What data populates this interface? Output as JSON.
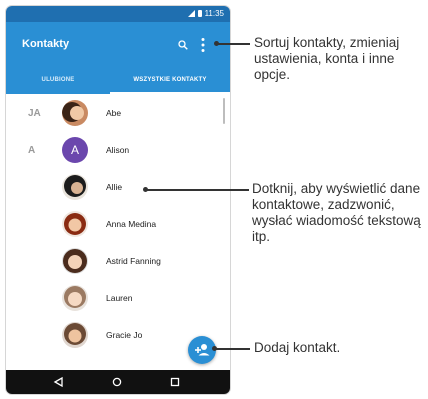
{
  "status_bar": {
    "time": "11:35"
  },
  "app_bar": {
    "title": "Kontakty"
  },
  "tabs": [
    {
      "label": "ULUBIONE",
      "active": false
    },
    {
      "label": "WSZYSTKIE KONTAKTY",
      "active": true
    }
  ],
  "contacts": [
    {
      "section": "JA",
      "name": "Abe",
      "avatar": "photo"
    },
    {
      "section": "A",
      "name": "Alison",
      "avatar": "letter",
      "initial": "A"
    },
    {
      "section": "",
      "name": "Allie",
      "avatar": "photo"
    },
    {
      "section": "",
      "name": "Anna Medina",
      "avatar": "photo"
    },
    {
      "section": "",
      "name": "Astrid Fanning",
      "avatar": "photo"
    },
    {
      "section": "",
      "name": "Lauren",
      "avatar": "photo"
    },
    {
      "section": "",
      "name": "Gracie Jo",
      "avatar": "photo"
    }
  ],
  "callouts": {
    "menu": "Sortuj kontakty, zmieniaj ustawienia, konta i inne opcje.",
    "contact": "Dotknij, aby wyświetlić dane kontaktowe, zadzwonić, wysłać wiadomość tekstową itp.",
    "add": "Dodaj kontakt."
  },
  "colors": {
    "primary": "#2a8fd4",
    "status_bar": "#1f6fb0",
    "letter_avatar": "#6b47ad"
  }
}
